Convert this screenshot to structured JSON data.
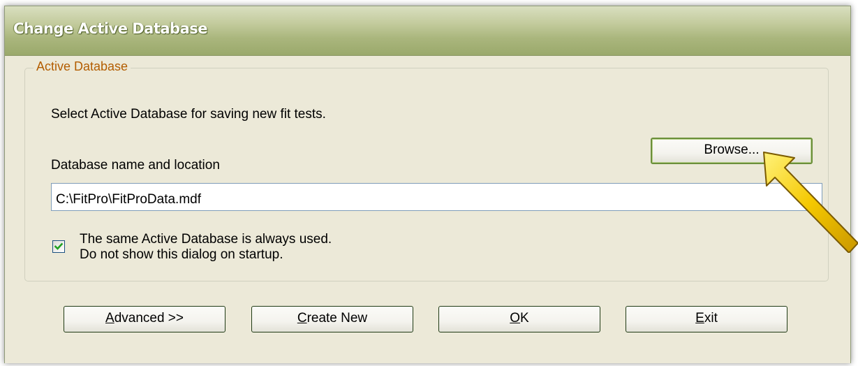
{
  "dialog": {
    "title": "Change Active Database"
  },
  "group": {
    "legend": "Active Database",
    "instruction": "Select Active Database for saving new fit tests.",
    "db_label": "Database name and location",
    "db_path": "C:\\FitPro\\FitProData.mdf",
    "browse_label": "Browse...",
    "checkbox_checked": true,
    "checkbox_line1": "The same Active Database is always used.",
    "checkbox_line2": "Do not show this dialog on startup."
  },
  "buttons": {
    "advanced": {
      "mnemonic": "A",
      "rest": "dvanced >>"
    },
    "create_new": {
      "mnemonic": "C",
      "rest": "reate New"
    },
    "ok": {
      "mnemonic": "O",
      "rest": "K"
    },
    "exit": {
      "mnemonic": "E",
      "rest": "xit"
    }
  },
  "overlay": {
    "arrow_icon": "yellow-pointer-arrow-icon",
    "arrow_color": "#f5c800"
  }
}
